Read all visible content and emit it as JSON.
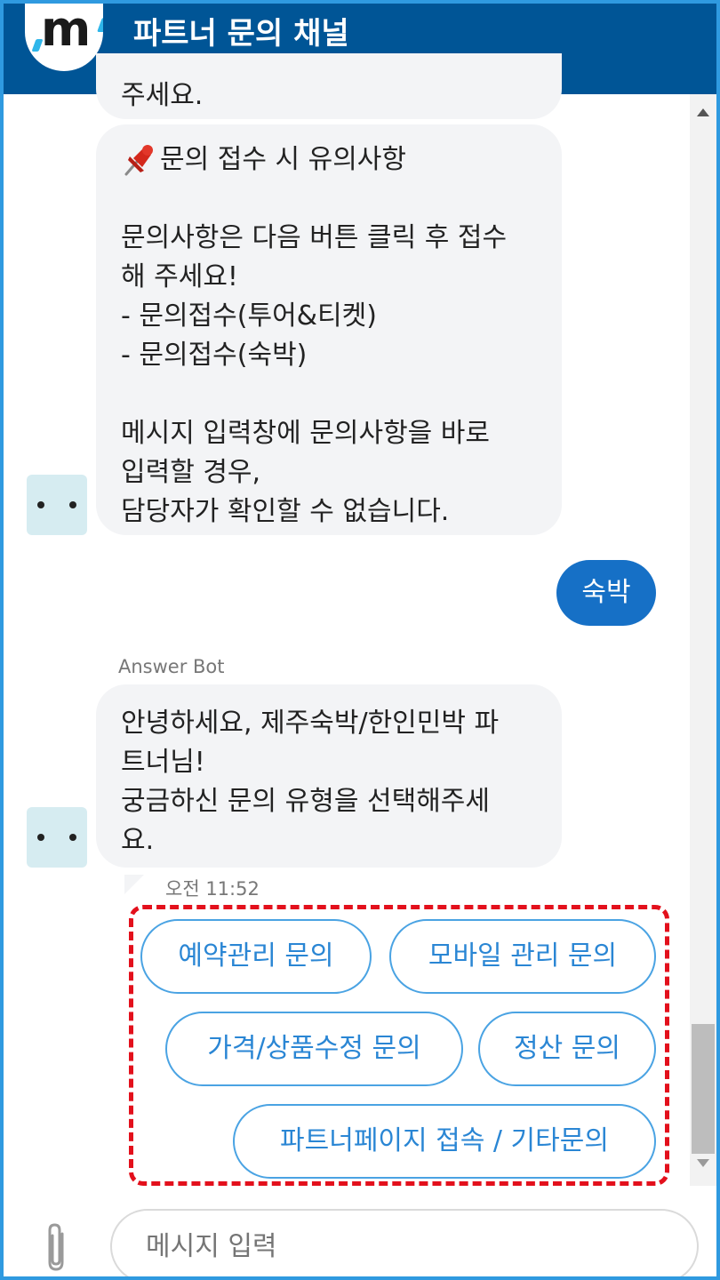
{
  "header": {
    "logo_letter": "m",
    "title": "파트너 문의 채널"
  },
  "messages": {
    "partial_line": "주세요.",
    "notice_lines": [
      "문의 접수 시 유의사항",
      "",
      "문의사항은 다음 버튼 클릭 후 접수",
      "해 주세요!",
      "- 문의접수(투어&티켓)",
      "- 문의접수(숙박)",
      "",
      "메시지 입력창에 문의사항을 바로",
      "입력할 경우,",
      "담당자가 확인할 수 없습니다."
    ],
    "user_reply": "숙박",
    "sender_name": "Answer Bot",
    "greeting_lines": [
      "안녕하세요, 제주숙박/한인민박 파",
      "트너님!",
      "궁금하신 문의 유형을 선택해주세",
      "요."
    ],
    "timestamp": "오전 11:52"
  },
  "quick_replies": [
    "예약관리 문의",
    "모바일 관리 문의",
    "가격/상품수정 문의",
    "정산 문의",
    "파트너페이지 접속 / 기타문의"
  ],
  "composer": {
    "placeholder": "메시지 입력"
  },
  "colors": {
    "header_bg": "#005596",
    "user_bubble": "#1670c6",
    "choice_border": "#4aa3e3",
    "highlight": "#e3101c"
  },
  "icons": {
    "pin": "pushpin-icon",
    "attach": "paperclip-icon"
  }
}
